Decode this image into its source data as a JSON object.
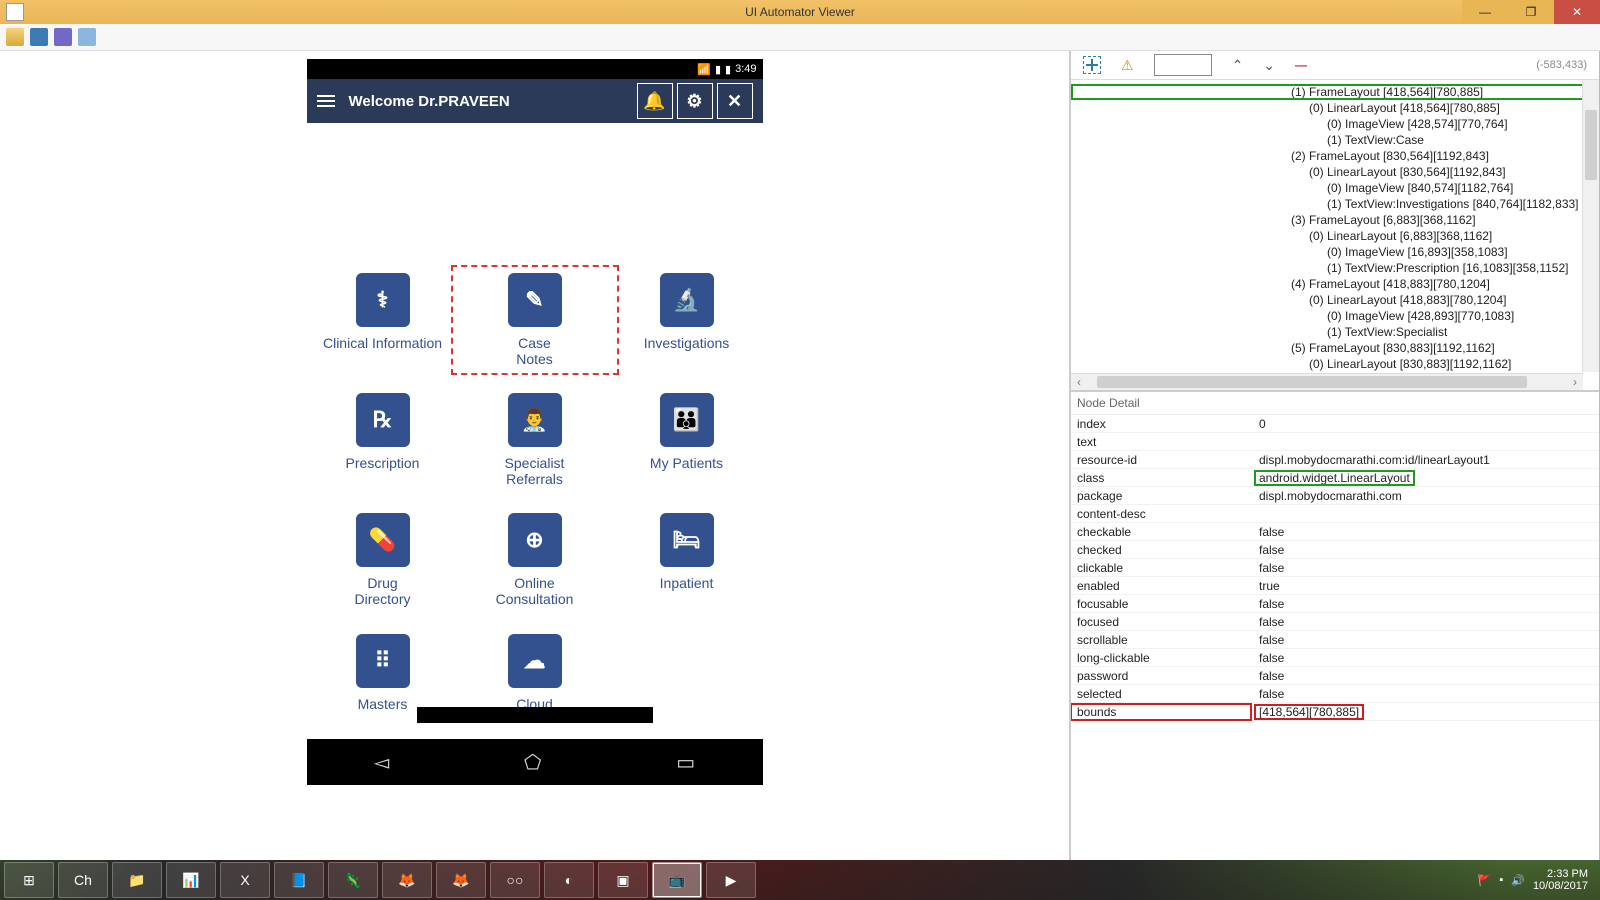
{
  "titlebar": {
    "title": "UI Automator Viewer"
  },
  "device": {
    "status_time": "3:49",
    "appbar_title": "Welcome Dr.PRAVEEN",
    "tiles": [
      {
        "icon": "⚕",
        "label": "Clinical Information",
        "selected": false
      },
      {
        "icon": "✎",
        "label": "Case\nNotes",
        "selected": true
      },
      {
        "icon": "🔬",
        "label": "Investigations",
        "selected": false
      },
      {
        "icon": "℞",
        "label": "Prescription",
        "selected": false
      },
      {
        "icon": "👨‍⚕️",
        "label": "Specialist\nReferrals",
        "selected": false
      },
      {
        "icon": "👪",
        "label": "My Patients",
        "selected": false
      },
      {
        "icon": "💊",
        "label": "Drug\nDirectory",
        "selected": false
      },
      {
        "icon": "⊕",
        "label": "Online\nConsultation",
        "selected": false
      },
      {
        "icon": "🛏",
        "label": "Inpatient",
        "selected": false
      },
      {
        "icon": "⠿",
        "label": "Masters",
        "selected": false
      },
      {
        "icon": "☁",
        "label": "Cloud",
        "selected": false
      }
    ]
  },
  "tree_toolbar": {
    "coords": "(-583,433)"
  },
  "tree": [
    {
      "indent": 0,
      "text": "(1) FrameLayout [418,564][780,885]",
      "hl": true
    },
    {
      "indent": 1,
      "text": "(0) LinearLayout [418,564][780,885]"
    },
    {
      "indent": 2,
      "text": "(0) ImageView [428,574][770,764]"
    },
    {
      "indent": 2,
      "text": "(1) TextView:Case"
    },
    {
      "indent": 0,
      "text": "(2) FrameLayout [830,564][1192,843]"
    },
    {
      "indent": 1,
      "text": "(0) LinearLayout [830,564][1192,843]"
    },
    {
      "indent": 2,
      "text": "(0) ImageView [840,574][1182,764]"
    },
    {
      "indent": 2,
      "text": "(1) TextView:Investigations [840,764][1182,833]"
    },
    {
      "indent": 0,
      "text": "(3) FrameLayout [6,883][368,1162]"
    },
    {
      "indent": 1,
      "text": "(0) LinearLayout [6,883][368,1162]"
    },
    {
      "indent": 2,
      "text": "(0) ImageView [16,893][358,1083]"
    },
    {
      "indent": 2,
      "text": "(1) TextView:Prescription [16,1083][358,1152]"
    },
    {
      "indent": 0,
      "text": "(4) FrameLayout [418,883][780,1204]"
    },
    {
      "indent": 1,
      "text": "(0) LinearLayout [418,883][780,1204]"
    },
    {
      "indent": 2,
      "text": "(0) ImageView [428,893][770,1083]"
    },
    {
      "indent": 2,
      "text": "(1) TextView:Specialist"
    },
    {
      "indent": 0,
      "text": "(5) FrameLayout [830,883][1192,1162]"
    },
    {
      "indent": 1,
      "text": "(0) LinearLayout [830,883][1192,1162]"
    }
  ],
  "detail_header": "Node Detail",
  "props": [
    {
      "k": "index",
      "v": "0"
    },
    {
      "k": "text",
      "v": ""
    },
    {
      "k": "resource-id",
      "v": "displ.mobydocmarathi.com:id/linearLayout1"
    },
    {
      "k": "class",
      "v": "android.widget.LinearLayout",
      "vbox": "green"
    },
    {
      "k": "package",
      "v": "displ.mobydocmarathi.com"
    },
    {
      "k": "content-desc",
      "v": ""
    },
    {
      "k": "checkable",
      "v": "false"
    },
    {
      "k": "checked",
      "v": "false"
    },
    {
      "k": "clickable",
      "v": "false"
    },
    {
      "k": "enabled",
      "v": "true"
    },
    {
      "k": "focusable",
      "v": "false"
    },
    {
      "k": "focused",
      "v": "false"
    },
    {
      "k": "scrollable",
      "v": "false"
    },
    {
      "k": "long-clickable",
      "v": "false"
    },
    {
      "k": "password",
      "v": "false"
    },
    {
      "k": "selected",
      "v": "false"
    },
    {
      "k": "bounds",
      "v": "[418,564][780,885]",
      "kbox": "red",
      "vbox": "red"
    }
  ],
  "taskbar": {
    "apps": [
      "⊞",
      "Ch",
      "📁",
      "📊",
      "X",
      "📘",
      "🦎",
      "🦊",
      "🦊",
      "○○",
      "◐",
      "▣",
      "📺",
      "▶"
    ],
    "active_index": 12,
    "time": "2:33 PM",
    "date": "10/08/2017"
  }
}
